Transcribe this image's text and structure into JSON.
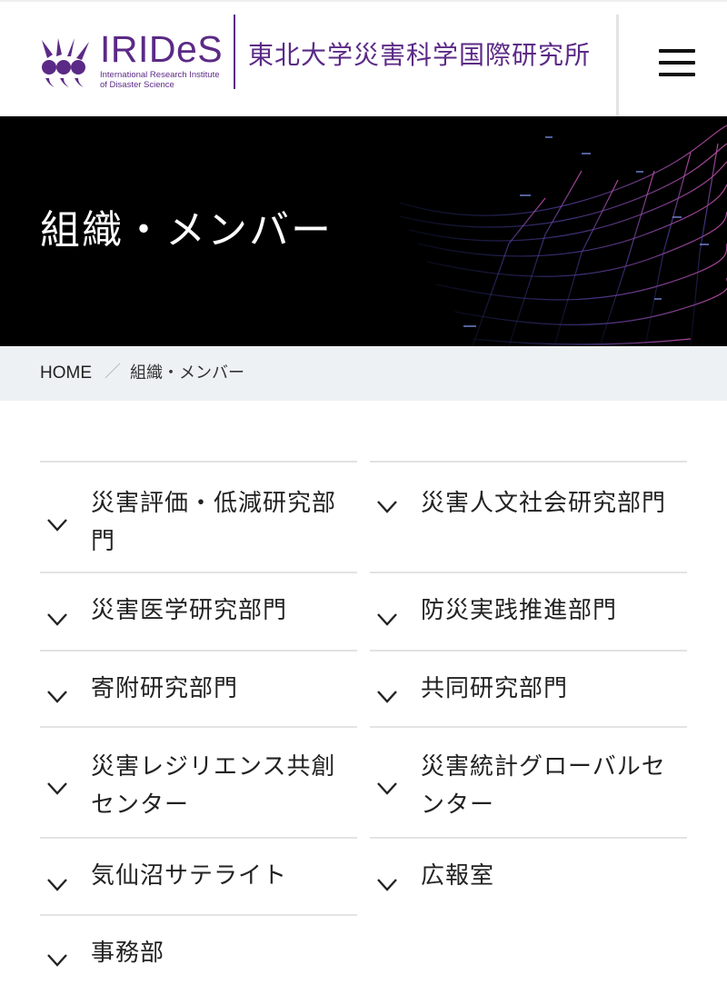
{
  "header": {
    "logo_text": "IRIDeS",
    "logo_subtitle_line1": "International Research Institute",
    "logo_subtitle_line2": "of Disaster Science",
    "org_name": "東北大学災害科学国際研究所",
    "brand_color": "#5b2a86",
    "menu_icon": "hamburger-icon"
  },
  "hero": {
    "title": "組織・メンバー",
    "background": "#000000"
  },
  "breadcrumb": {
    "home": "HOME",
    "separator": "／",
    "current": "組織・メンバー"
  },
  "departments": [
    {
      "label": "災害評価・低減研究部門"
    },
    {
      "label": "災害人文社会研究部門"
    },
    {
      "label": "災害医学研究部門"
    },
    {
      "label": "防災実践推進部門"
    },
    {
      "label": "寄附研究部門"
    },
    {
      "label": "共同研究部門"
    },
    {
      "label": "災害レジリエンス共創センター"
    },
    {
      "label": "災害統計グローバルセンター"
    },
    {
      "label": "気仙沼サテライト"
    },
    {
      "label": "広報室"
    },
    {
      "label": "事務部"
    }
  ],
  "icons": {
    "expand": "chevron-down-icon"
  }
}
